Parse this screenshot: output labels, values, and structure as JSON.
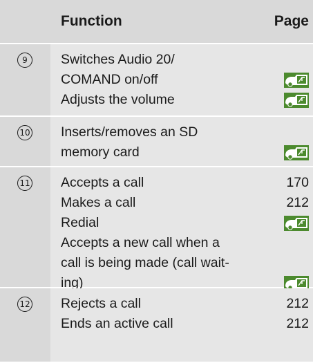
{
  "header": {
    "function_label": "Function",
    "page_label": "Page"
  },
  "sections": [
    {
      "num": "9",
      "rows": [
        {
          "text_lines": [
            "Switches Audio 20/",
            "COMAND on/off"
          ],
          "page": null,
          "page_icon": "vehicle-manual-ref-icon"
        },
        {
          "text_lines": [
            "Adjusts the volume"
          ],
          "page": null,
          "page_icon": "vehicle-manual-ref-icon"
        }
      ]
    },
    {
      "num": "10",
      "rows": [
        {
          "text_lines": [
            "Inserts/removes an SD",
            "memory card"
          ],
          "page": null,
          "page_icon": "vehicle-manual-ref-icon"
        }
      ]
    },
    {
      "num": "11",
      "rows": [
        {
          "text_lines": [
            "Accepts a call"
          ],
          "page": "170"
        },
        {
          "text_lines": [
            "Makes a call"
          ],
          "page": "212"
        },
        {
          "text_lines": [
            "Redial"
          ],
          "page": null,
          "page_icon": "vehicle-manual-ref-icon"
        },
        {
          "text_lines": [
            "Accepts a new call when a",
            "call is being made (call wait-",
            "ing)"
          ],
          "page": null,
          "page_icon": "vehicle-manual-ref-icon"
        }
      ]
    },
    {
      "num": "12",
      "rows": [
        {
          "text_lines": [
            "Rejects a call"
          ],
          "page": "212"
        },
        {
          "text_lines": [
            "Ends an active call"
          ],
          "page": "212"
        }
      ]
    }
  ],
  "colors": {
    "number_column_bg": "#d9d9d9",
    "body_bg": "#e6e6e6",
    "icon_green": "#4c8a2e"
  }
}
